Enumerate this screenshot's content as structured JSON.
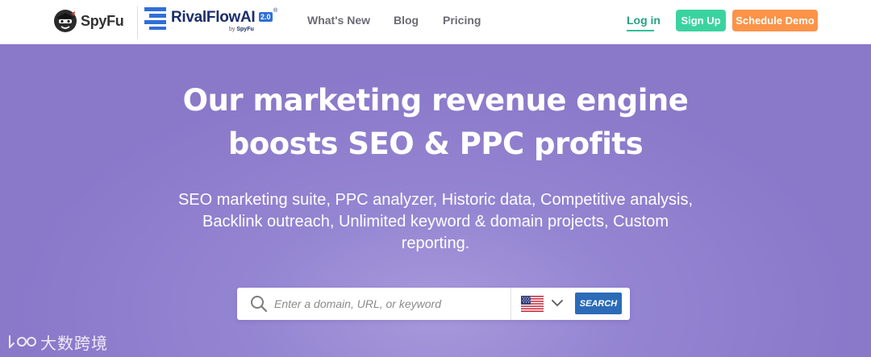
{
  "header": {
    "spyfu_logo_text": "SpyFu",
    "rivalflow_logo_text": "RivalFlowAI",
    "rivalflow_version": "2.0",
    "rivalflow_by_prefix": "by",
    "rivalflow_by_brand": "SpyFu",
    "nav": {
      "whats_new": "What's New",
      "blog": "Blog",
      "pricing": "Pricing"
    },
    "login_label": "Log in",
    "signup_label": "Sign Up",
    "demo_label": "Schedule Demo"
  },
  "hero": {
    "title_line1": "Our marketing revenue engine",
    "title_line2": "boosts SEO & PPC profits",
    "subtitle_line1": "SEO marketing suite, PPC analyzer, Historic data, Competitive analysis,",
    "subtitle_line2": "Backlink outreach, Unlimited keyword & domain projects, Custom",
    "subtitle_line3": "reporting."
  },
  "search": {
    "placeholder": "Enter a domain, URL, or keyword",
    "value": "",
    "country_flag": "us-flag-icon",
    "button_label": "SEARCH"
  },
  "watermark": {
    "text": "大数跨境"
  },
  "colors": {
    "hero_bg": "#8a78c9",
    "signup": "#3ad3a0",
    "demo": "#fb9348",
    "login": "#26a383",
    "search_button": "#2b6bb8"
  }
}
